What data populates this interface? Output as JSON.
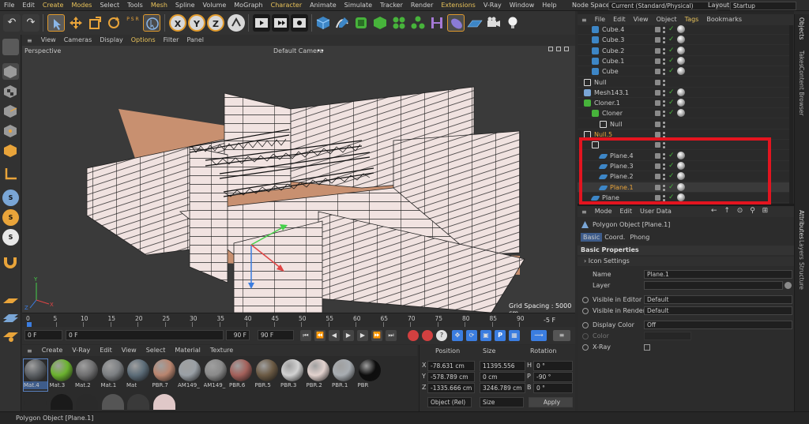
{
  "menu": [
    "File",
    "Edit",
    "Create",
    "Modes",
    "Select",
    "Tools",
    "Mesh",
    "Spline",
    "Volume",
    "MoGraph",
    "Character",
    "Animate",
    "Simulate",
    "Tracker",
    "Render",
    "Extensions",
    "V-Ray",
    "Window",
    "Help"
  ],
  "node_space": {
    "label": "Node Space:",
    "value": "Current (Standard/Physical)"
  },
  "layout": {
    "label": "Layout:",
    "value": "Startup"
  },
  "viewport": {
    "menu": [
      "View",
      "Cameras",
      "Display",
      "Options",
      "Filter",
      "Panel"
    ],
    "name": "Perspective",
    "camera": "Default Camera",
    "camera_icon": "••",
    "grid_spacing": "Grid Spacing : 5000 cm"
  },
  "timeline": {
    "ticks": [
      "0",
      "5",
      "10",
      "15",
      "20",
      "25",
      "30",
      "35",
      "40",
      "45",
      "50",
      "55",
      "60",
      "65",
      "70",
      "75",
      "80",
      "85",
      "90"
    ],
    "end_field": "-5 F",
    "start": "0 F",
    "current": "0 F",
    "end": "90 F",
    "max": "90 F"
  },
  "material_manager": {
    "menu": [
      "Create",
      "V-Ray",
      "Edit",
      "View",
      "Select",
      "Material",
      "Texture"
    ],
    "materials": [
      {
        "name": "Mat.4",
        "color": "#5b5f63"
      },
      {
        "name": "Mat.3",
        "color": "#6bb32e"
      },
      {
        "name": "Mat.2",
        "color": "#6f6f70"
      },
      {
        "name": "Mat.1",
        "color": "#7c7f82"
      },
      {
        "name": "Mat",
        "color": "#5c6c78"
      },
      {
        "name": "PBR.7",
        "color": "#b9856f"
      },
      {
        "name": "AM149_",
        "color": "#9aa0a6"
      },
      {
        "name": "AM149_",
        "color": "#8a8a8a"
      },
      {
        "name": "PBR.6",
        "color": "#a4605a"
      },
      {
        "name": "PBR.5",
        "color": "#6b5a44"
      },
      {
        "name": "PBR.3",
        "color": "#d2d2d2"
      },
      {
        "name": "PBR.2",
        "color": "#e2d2ce"
      },
      {
        "name": "PBR.1",
        "color": "#a8adb2"
      },
      {
        "name": "PBR",
        "color": "#0d0d0d"
      }
    ]
  },
  "coordinates": {
    "headers": [
      "Position",
      "Size",
      "Rotation"
    ],
    "rows": [
      {
        "axis": "X",
        "pos": "-78.631 cm",
        "size": "11395.556 cm",
        "rot_axis": "H",
        "rot": "0 °"
      },
      {
        "axis": "Y",
        "pos": "-578.789 cm",
        "size": "0 cm",
        "rot_axis": "P",
        "rot": "-90 °"
      },
      {
        "axis": "Z",
        "pos": "-1335.666 cm",
        "size": "3246.789 cm",
        "rot_axis": "B",
        "rot": "0 °"
      }
    ],
    "mode": "Object (Rel)",
    "size_mode": "Size",
    "apply": "Apply"
  },
  "object_manager": {
    "menu": [
      "File",
      "Edit",
      "View",
      "Object",
      "Tags",
      "Bookmarks"
    ],
    "objects": [
      {
        "name": "Cube.4",
        "indent": 1,
        "icon": "cube"
      },
      {
        "name": "Cube.3",
        "indent": 1,
        "icon": "cube"
      },
      {
        "name": "Cube.2",
        "indent": 1,
        "icon": "cube"
      },
      {
        "name": "Cube.1",
        "indent": 1,
        "icon": "cube"
      },
      {
        "name": "Cube",
        "indent": 1,
        "icon": "cube"
      },
      {
        "name": "Null",
        "indent": 0,
        "icon": "null"
      },
      {
        "name": "Mesh143.1",
        "indent": 0,
        "icon": "mesh"
      },
      {
        "name": "Cloner.1",
        "indent": 0,
        "icon": "cloner"
      },
      {
        "name": "Cloner",
        "indent": 1,
        "icon": "cloner"
      },
      {
        "name": "Null",
        "indent": 2,
        "icon": "null"
      },
      {
        "name": "Null.5",
        "indent": 0,
        "icon": "null",
        "orange": true
      },
      {
        "name": "",
        "indent": 1,
        "icon": "null"
      },
      {
        "name": "Plane.4",
        "indent": 2,
        "icon": "plane"
      },
      {
        "name": "Plane.3",
        "indent": 2,
        "icon": "plane"
      },
      {
        "name": "Plane.2",
        "indent": 2,
        "icon": "plane"
      },
      {
        "name": "Plane.1",
        "indent": 2,
        "icon": "plane",
        "selected": true
      },
      {
        "name": "Plane",
        "indent": 1,
        "icon": "plane"
      }
    ]
  },
  "attributes": {
    "menu": [
      "Mode",
      "Edit",
      "User Data"
    ],
    "object_title": "Polygon Object [Plane.1]",
    "tabs": [
      "Basic",
      "Coord.",
      "Phong"
    ],
    "section": "Basic Properties",
    "icon_settings": "Icon Settings",
    "name_label": "Name",
    "name_value": "Plane.1",
    "layer_label": "Layer",
    "visible_editor_label": "Visible in Editor",
    "visible_editor_value": "Default",
    "visible_renderer_label": "Visible in Renderer",
    "visible_renderer_value": "Default",
    "display_color_label": "Display Color",
    "display_color_value": "Off",
    "color_label": "Color",
    "xray_label": "X-Ray"
  },
  "side_tabs": [
    "Objects",
    "Takes",
    "Content Browser",
    "Attributes",
    "Layers",
    "Structure"
  ],
  "status": "Polygon Object [Plane.1]",
  "colors": {
    "accent": "#e3141f",
    "selection": "#3e5c8a",
    "menu_yellow": "#e8c25a"
  }
}
